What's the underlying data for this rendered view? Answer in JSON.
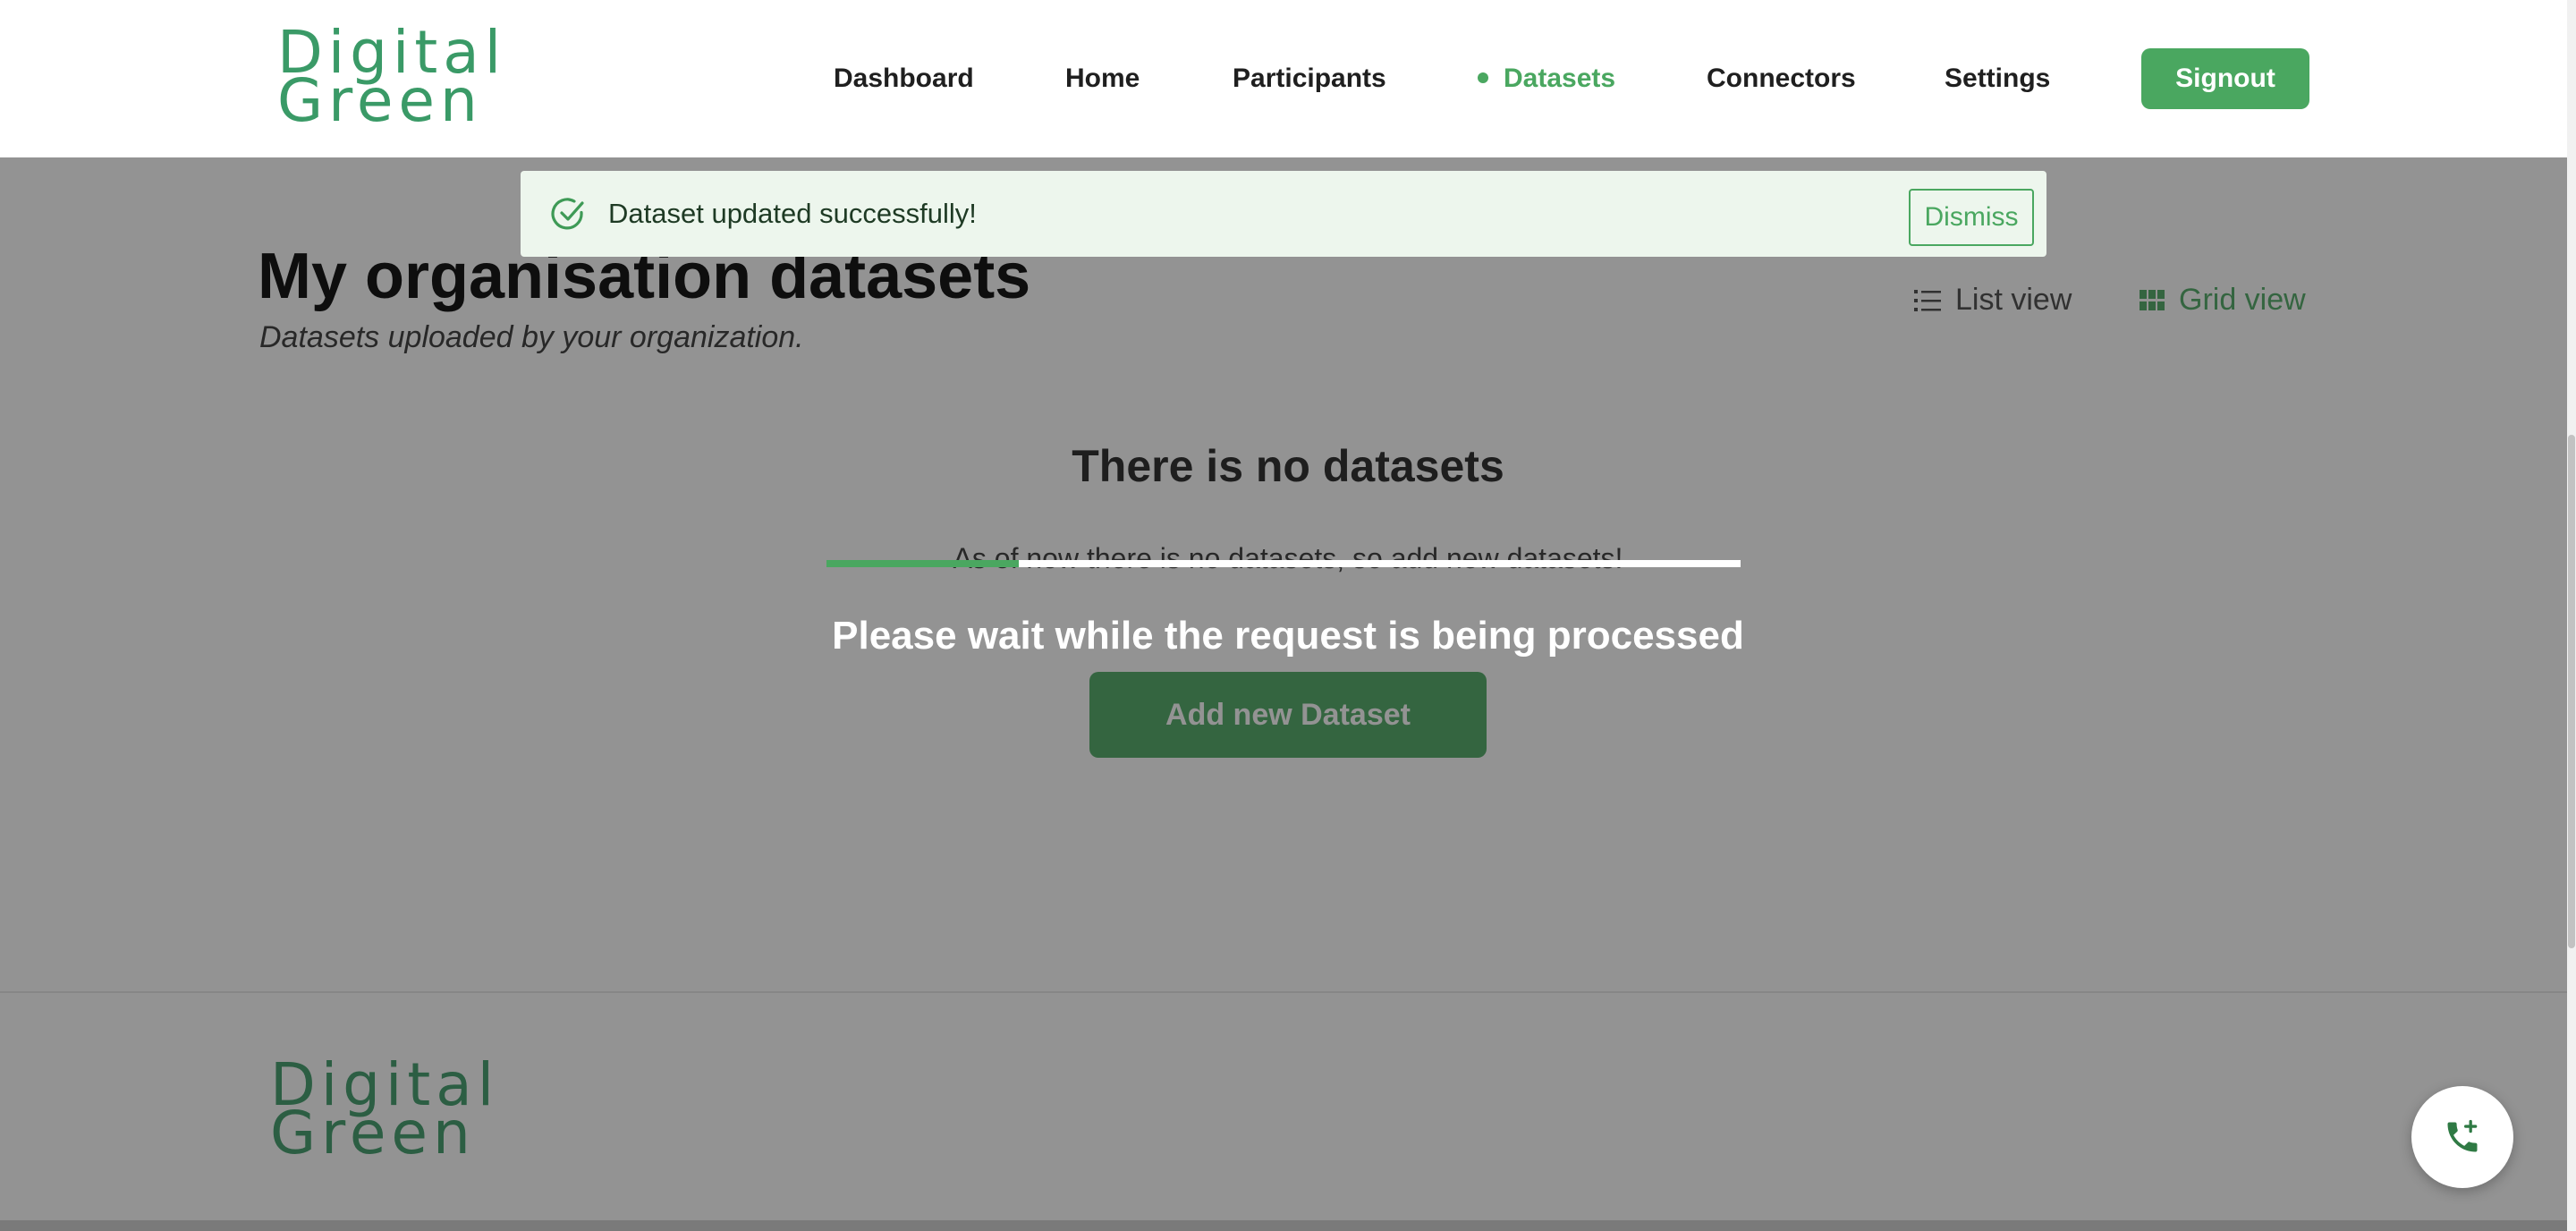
{
  "header": {
    "logo_line1": "Digital",
    "logo_line2": "Green",
    "nav": [
      {
        "label": "Dashboard",
        "active": false
      },
      {
        "label": "Home",
        "active": false
      },
      {
        "label": "Participants",
        "active": false
      },
      {
        "label": "Datasets",
        "active": true
      },
      {
        "label": "Connectors",
        "active": false
      },
      {
        "label": "Settings",
        "active": false
      }
    ],
    "signout_label": "Signout"
  },
  "main": {
    "title": "My organisation datasets",
    "subtitle": "Datasets uploaded by your organization.",
    "list_view_label": "List view",
    "grid_view_label": "Grid view",
    "list_view_icon": "list-icon",
    "grid_view_icon": "grid-icon",
    "empty_title": "There is no datasets",
    "empty_text": "As of now there is no datasets, so add new datasets!",
    "add_button_label": "Add new Dataset"
  },
  "toast": {
    "icon": "check-circle-icon",
    "message": "Dataset updated successfully!",
    "dismiss_label": "Dismiss"
  },
  "overlay": {
    "message": "Please wait while the request is being processed",
    "progress_fraction": 0.21
  },
  "footer": {
    "logo_line1": "Digital",
    "logo_line2": "Green"
  },
  "fab": {
    "icon": "phone-add-icon"
  },
  "colors": {
    "brand_green": "#4aa760",
    "logo_green": "#3a9a67",
    "toast_background": "#edf6ed",
    "overlay": "rgba(30,30,30,0.48)"
  }
}
